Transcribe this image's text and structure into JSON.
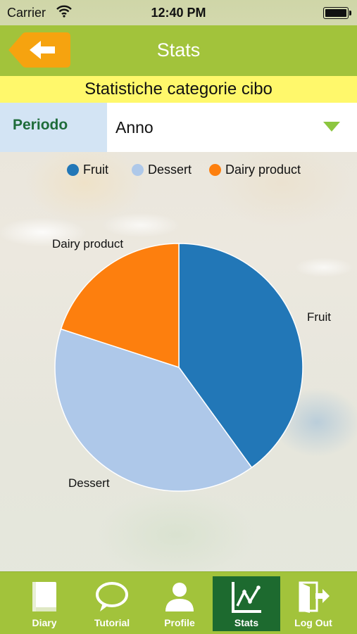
{
  "status_bar": {
    "carrier": "Carrier",
    "time": "12:40 PM"
  },
  "navbar": {
    "title": "Stats"
  },
  "subtitle": "Statistiche categorie cibo",
  "period": {
    "label": "Periodo",
    "value": "Anno"
  },
  "colors": {
    "fruit": "#2277b7",
    "dessert": "#aec8e9",
    "dairy": "#fd7f0e",
    "bar_green": "#a2c33b",
    "active_tab": "#1d6a2f",
    "subtitle_bg": "#fff86b"
  },
  "chart_data": {
    "type": "pie",
    "title": "",
    "categories": [
      "Fruit",
      "Dessert",
      "Dairy product"
    ],
    "values": [
      40,
      40,
      20
    ],
    "colors": [
      "#2277b7",
      "#aec8e9",
      "#fd7f0e"
    ],
    "legend": [
      "Fruit",
      "Dessert",
      "Dairy product"
    ],
    "legend_placement": "top"
  },
  "tabs": [
    {
      "label": "Diary",
      "icon": "book-icon",
      "active": false
    },
    {
      "label": "Tutorial",
      "icon": "speech-bubble-icon",
      "active": false
    },
    {
      "label": "Profile",
      "icon": "person-icon",
      "active": false
    },
    {
      "label": "Stats",
      "icon": "chart-icon",
      "active": true
    },
    {
      "label": "Log Out",
      "icon": "exit-door-icon",
      "active": false
    }
  ]
}
